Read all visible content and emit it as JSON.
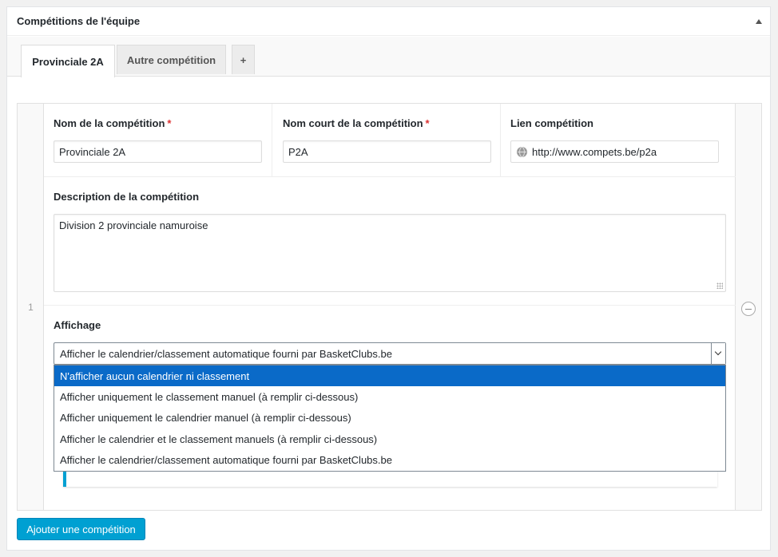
{
  "metabox": {
    "title": "Compétitions de l'équipe"
  },
  "tabs": [
    {
      "label": "Provinciale 2A",
      "active": true
    },
    {
      "label": "Autre compétition",
      "active": false
    },
    {
      "label": "+",
      "active": false
    }
  ],
  "row": {
    "number": "1",
    "fields": {
      "name": {
        "label": "Nom de la compétition",
        "required_mark": "*",
        "value": "Provinciale 2A"
      },
      "short_name": {
        "label": "Nom court de la compétition",
        "required_mark": "*",
        "value": "P2A"
      },
      "link": {
        "label": "Lien compétition",
        "value": "http://www.compets.be/p2a"
      },
      "description": {
        "label": "Description de la compétition",
        "value": "Division 2 provinciale namuroise"
      },
      "display": {
        "label": "Affichage",
        "selected": "Afficher le calendrier/classement automatique fourni par BasketClubs.be",
        "options": [
          "N'afficher aucun calendrier ni classement",
          "Afficher uniquement le classement manuel (à remplir ci-dessous)",
          "Afficher uniquement le calendrier manuel (à remplir ci-dessous)",
          "Afficher le calendrier et le classement manuels (à remplir ci-dessous)",
          "Afficher le calendrier/classement automatique fourni par BasketClubs.be"
        ],
        "highlighted_index": 0
      }
    }
  },
  "actions": {
    "add_label": "Ajouter une compétition"
  },
  "colors": {
    "accent": "#00a0d2",
    "highlight": "#0a6ac8",
    "required": "#dc3232"
  }
}
